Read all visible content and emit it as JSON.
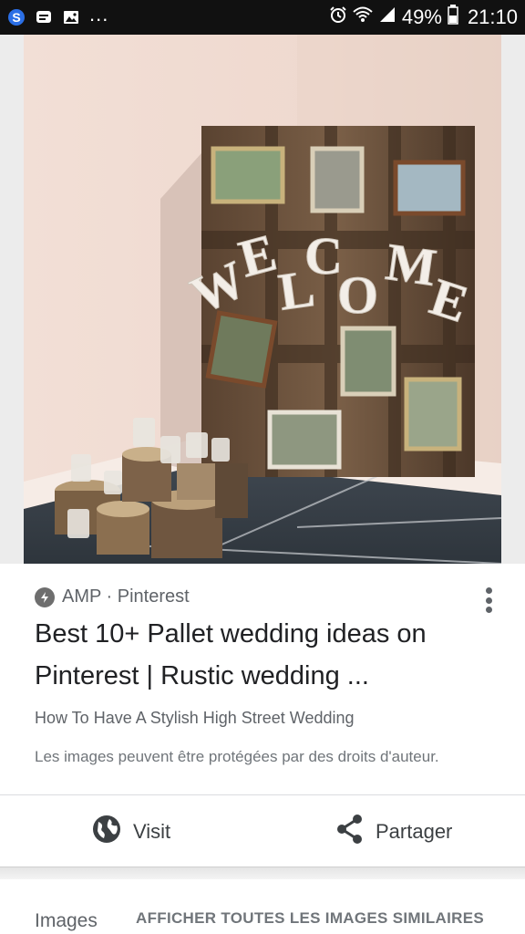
{
  "status_bar": {
    "dots": "...",
    "battery_percent": "49%",
    "time": "21:10",
    "icons": [
      "s-app-icon",
      "message-icon",
      "image-icon",
      "alarm-icon",
      "wifi-icon",
      "signal-icon",
      "battery-icon"
    ]
  },
  "image": {
    "welcome_letters": [
      "W",
      "E",
      "L",
      "C",
      "O",
      "M",
      "E"
    ]
  },
  "result": {
    "source": "AMP · Pinterest",
    "title": "Best 10+ Pallet wedding ideas on Pinterest | Rustic wedding ...",
    "subtitle": "How To Have A Stylish High Street Wedding",
    "copyright": "Les images peuvent être protégées par des droits d'auteur."
  },
  "actions": {
    "visit_label": "Visit",
    "share_label": "Partager"
  },
  "related": {
    "images_label": "Images",
    "see_all_label": "AFFICHER TOUTES LES IMAGES SIMILAIRES"
  },
  "colors": {
    "status_bar_bg": "#111111",
    "text_primary": "#202124",
    "text_secondary": "#5f6368"
  }
}
